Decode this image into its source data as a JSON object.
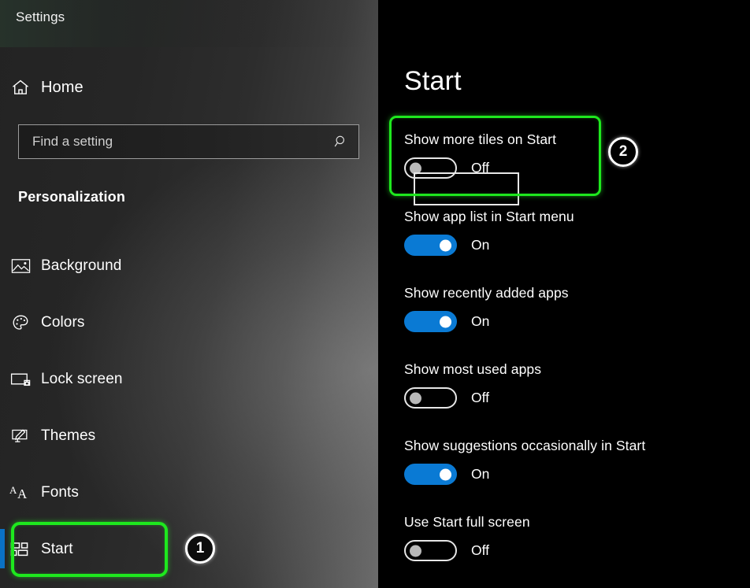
{
  "window": {
    "title": "Settings"
  },
  "sidebar": {
    "home": {
      "label": "Home",
      "icon": "home-icon"
    },
    "search": {
      "placeholder": "Find a setting",
      "value": "",
      "icon": "search-icon"
    },
    "section_header": "Personalization",
    "items": [
      {
        "label": "Background",
        "icon": "picture-icon",
        "selected": false
      },
      {
        "label": "Colors",
        "icon": "palette-icon",
        "selected": false
      },
      {
        "label": "Lock screen",
        "icon": "lock-screen-icon",
        "selected": false
      },
      {
        "label": "Themes",
        "icon": "themes-brush-icon",
        "selected": false
      },
      {
        "label": "Fonts",
        "icon": "fonts-aa-icon",
        "selected": false
      },
      {
        "label": "Start",
        "icon": "start-tiles-icon",
        "selected": true
      }
    ]
  },
  "main": {
    "page_title": "Start",
    "settings": [
      {
        "label": "Show more tiles on Start",
        "state": "Off",
        "on": false,
        "focused": true,
        "highlighted": true
      },
      {
        "label": "Show app list in Start menu",
        "state": "On",
        "on": true,
        "focused": false,
        "highlighted": false
      },
      {
        "label": "Show recently added apps",
        "state": "On",
        "on": true,
        "focused": false,
        "highlighted": false
      },
      {
        "label": "Show most used apps",
        "state": "Off",
        "on": false,
        "focused": false,
        "highlighted": false
      },
      {
        "label": "Show suggestions occasionally in Start",
        "state": "On",
        "on": true,
        "focused": false,
        "highlighted": false
      },
      {
        "label": "Use Start full screen",
        "state": "Off",
        "on": false,
        "focused": false,
        "highlighted": false
      }
    ]
  },
  "annotations": {
    "badges": [
      {
        "number": "1",
        "target": "sidebar-item-start"
      },
      {
        "number": "2",
        "target": "setting-show-more-tiles"
      }
    ],
    "highlight_color": "#1ee81e",
    "accent_color": "#0a7ad4",
    "selection_bar_color": "#0a72c4"
  },
  "watermark": {
    "name": "appuals-mascot-logo"
  }
}
